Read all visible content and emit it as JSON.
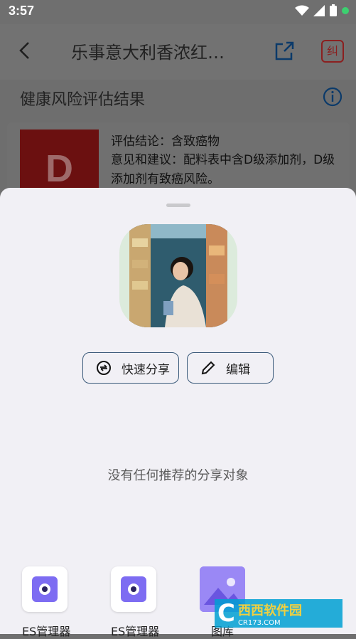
{
  "status": {
    "time": "3:57"
  },
  "appbar": {
    "title": "乐事意大利香浓红…",
    "report_label": "纠"
  },
  "section": {
    "title": "健康风险评估结果"
  },
  "card": {
    "grade": "D",
    "conclusion": "评估结论：含致癌物",
    "advice": "意见和建议：配料表中含D级添加剂，D级添加剂有致癌风险。"
  },
  "sheet": {
    "quick_share": "快速分享",
    "edit": "编辑",
    "empty_text": "没有任何推荐的分享对象",
    "apps": [
      {
        "label": "ES管理器",
        "icon": "es-file-manager-icon"
      },
      {
        "label": "ES管理器",
        "icon": "es-file-manager-icon"
      },
      {
        "label": "图库",
        "icon": "gallery-icon"
      }
    ]
  },
  "watermark": {
    "logo": "C",
    "title": "西西软件园",
    "url": "CR173.COM"
  },
  "colors": {
    "sheet_bg": "#f1f0f5",
    "grade_d": "#6b1010",
    "accent": "#3a5a7a"
  }
}
